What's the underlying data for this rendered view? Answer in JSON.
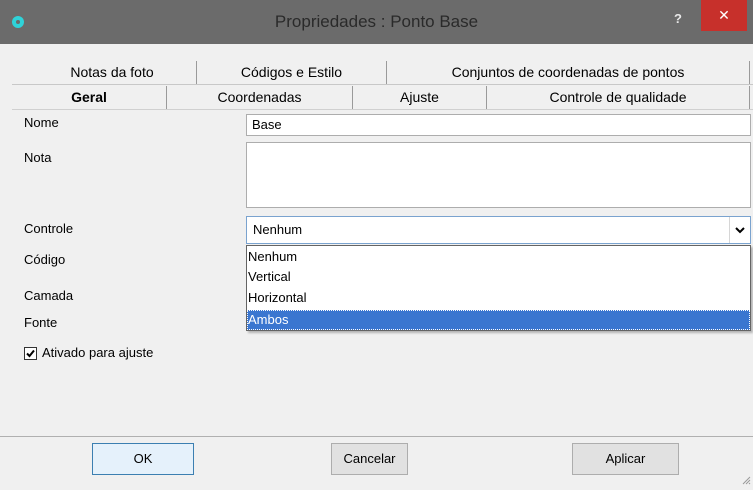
{
  "window": {
    "title": "Propriedades : Ponto Base",
    "help_label": "?",
    "close_label": "✕"
  },
  "tabs": {
    "row1": [
      "Notas da foto",
      "Códigos e Estilo",
      "Conjuntos de coordenadas de pontos"
    ],
    "row2": [
      "Geral",
      "Coordenadas",
      "Ajuste",
      "Controle de qualidade"
    ],
    "active": "Geral"
  },
  "form": {
    "nome_label": "Nome",
    "nome_value": "Base",
    "nota_label": "Nota",
    "nota_value": "",
    "controle_label": "Controle",
    "controle_value": "Nenhum",
    "codigo_label": "Código",
    "camada_label": "Camada",
    "fonte_label": "Fonte",
    "dropdown_options": [
      "Nenhum",
      "Vertical",
      "Horizontal",
      "Ambos"
    ],
    "dropdown_highlighted": "Ambos",
    "ativado_label": "Ativado para ajuste",
    "ativado_checked": true
  },
  "buttons": {
    "ok": "OK",
    "cancel": "Cancelar",
    "apply": "Aplicar"
  },
  "colors": {
    "titlebar": "#6b6b6b",
    "close": "#c7302b",
    "selection": "#3a76d0"
  }
}
